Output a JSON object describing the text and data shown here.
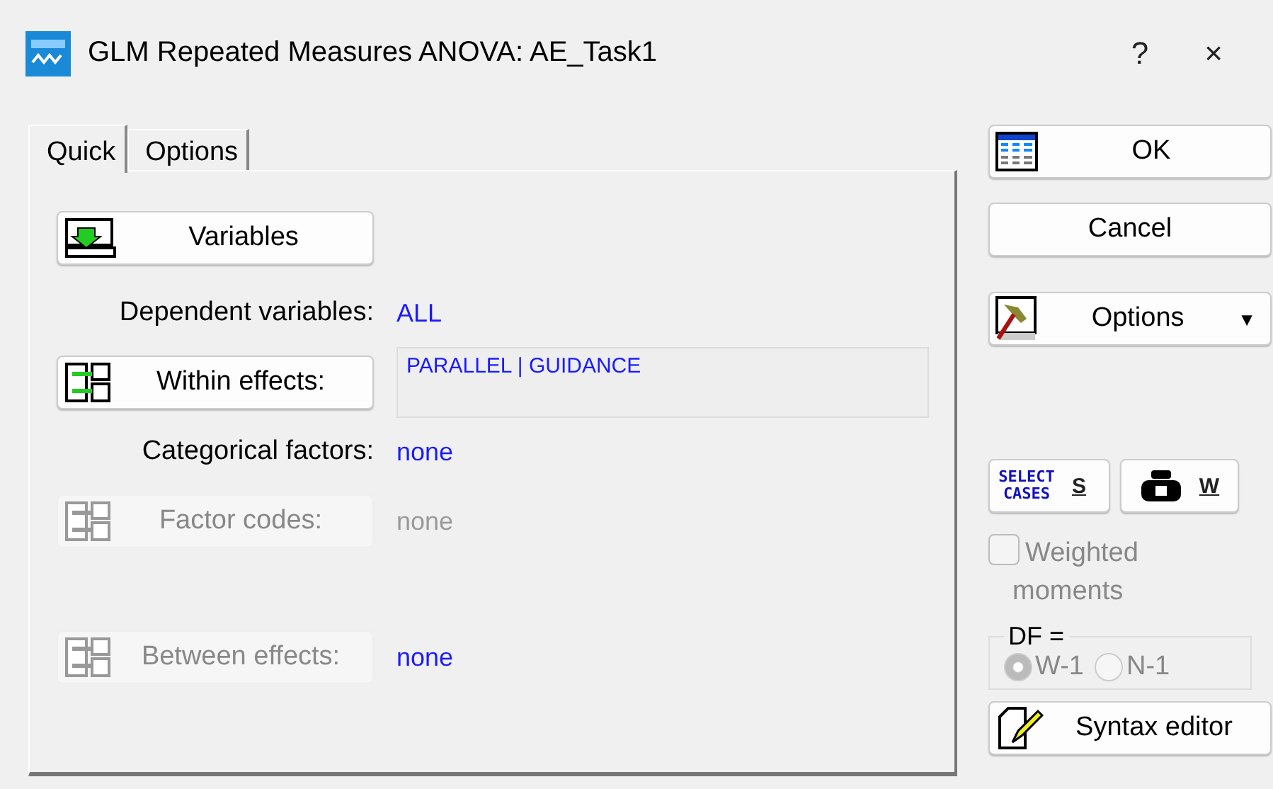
{
  "window": {
    "title": "GLM Repeated Measures ANOVA: AE_Task1",
    "help": "?",
    "close": "×"
  },
  "tabs": [
    {
      "label": "Quick",
      "selected": true
    },
    {
      "label": "Options",
      "selected": false
    }
  ],
  "panel": {
    "rows": [
      {
        "kind": "variables",
        "label": "Variables",
        "disabled": false
      },
      {
        "kind": "field",
        "label": "Dependent variables:",
        "value": "ALL"
      },
      {
        "kind": "effects_box",
        "label": "Within effects:",
        "disabled": false,
        "value": "PARALLEL | GUIDANCE"
      },
      {
        "kind": "field",
        "label": "Categorical factors:",
        "value": "none"
      },
      {
        "kind": "effects",
        "label": "Factor codes:",
        "disabled": true,
        "value": "none",
        "value_disabled": true
      }
    ],
    "between": {
      "kind": "effects",
      "label": "Between effects:",
      "disabled": true,
      "value": "none",
      "value_disabled": false
    }
  },
  "side": {
    "buttons": [
      {
        "kind": "ok",
        "label": "OK"
      },
      {
        "kind": "cancel",
        "label": "Cancel"
      },
      {
        "kind": "options",
        "label": "Options",
        "caret": "▼"
      }
    ],
    "small_buttons": [
      {
        "kind": "select",
        "icon_text": "SELECT CASES",
        "label": "S"
      },
      {
        "kind": "weight",
        "label": "W"
      }
    ],
    "weighted": {
      "label": "Weighted moments",
      "checked": false,
      "disabled": true
    },
    "df": {
      "title": "DF =",
      "disabled": true,
      "options": [
        {
          "label": "W-1",
          "selected": true
        },
        {
          "label": "N-1",
          "selected": false
        }
      ]
    },
    "syntax": {
      "label": "Syntax editor"
    }
  }
}
